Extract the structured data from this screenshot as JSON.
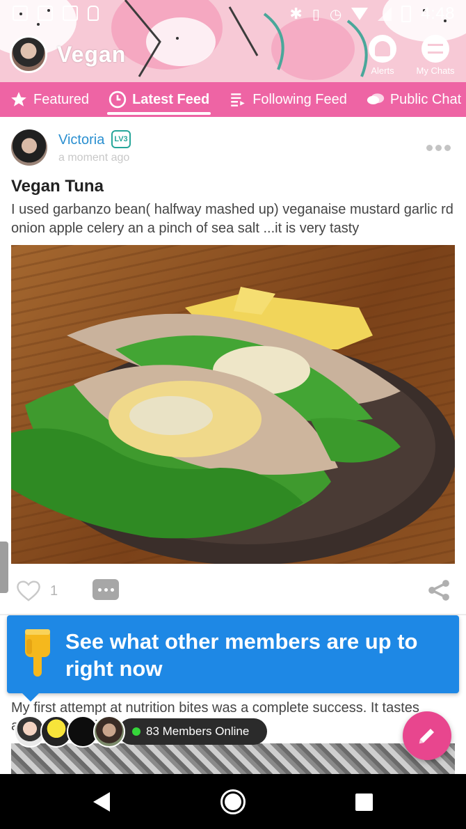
{
  "status_bar": {
    "time": "4:48"
  },
  "header": {
    "community_name": "Vegan",
    "alerts_label": "Alerts",
    "chats_label": "My Chats"
  },
  "tabs": [
    {
      "label": "Featured",
      "icon": "star-icon",
      "active": false
    },
    {
      "label": "Latest Feed",
      "icon": "clock-icon",
      "active": true
    },
    {
      "label": "Following Feed",
      "icon": "list-icon",
      "active": false
    },
    {
      "label": "Public Chat",
      "icon": "chat-bubble-icon",
      "active": false
    }
  ],
  "post": {
    "author": "Victoria",
    "level": "LV3",
    "time": "a moment ago",
    "title": "Vegan Tuna",
    "body": "I used garbanzo bean( halfway mashed up) veganaise mustard garlic rd onion apple celery an a pinch of sea salt ...it is very tasty",
    "likes": "1"
  },
  "tooltip": {
    "text": "See what other members are up to right now"
  },
  "next_post": {
    "body": "My first attempt at nutrition bites was a complete success. It tastes amazing and is nutritious"
  },
  "online": {
    "label": "83 Members Online"
  },
  "colors": {
    "header_pink": "#f7c9d6",
    "tab_pink": "#ee64a4",
    "author_blue": "#2a8fd0",
    "tooltip_blue": "#1e88e5",
    "fab_pink": "#e8468e",
    "online_green": "#35d63a"
  }
}
